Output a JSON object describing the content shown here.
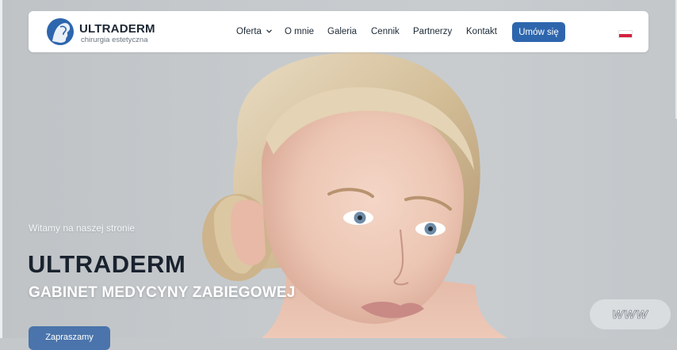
{
  "brand": {
    "name": "ULTRADERM",
    "tagline": "chirurgia estetyczna",
    "logo_icon": "face-profile-icon",
    "color": "#2e66ad"
  },
  "nav": {
    "items": [
      {
        "label": "Oferta",
        "has_dropdown": true
      },
      {
        "label": "O mnie"
      },
      {
        "label": "Galeria"
      },
      {
        "label": "Cennik"
      },
      {
        "label": "Partnerzy"
      },
      {
        "label": "Kontakt"
      }
    ],
    "cta_label": "Umów się",
    "language_icon": "flag-pl-icon"
  },
  "hero": {
    "welcome": "Witamy na naszej stronie",
    "title": "ULTRADERM",
    "subtitle": "GABINET MEDYCYNY ZABIEGOWEJ",
    "button_label": "Zapraszamy",
    "badge": "WWW"
  },
  "colors": {
    "accent": "#2e66ad",
    "title_dark": "#19222e",
    "flag_red": "#d4213d"
  }
}
